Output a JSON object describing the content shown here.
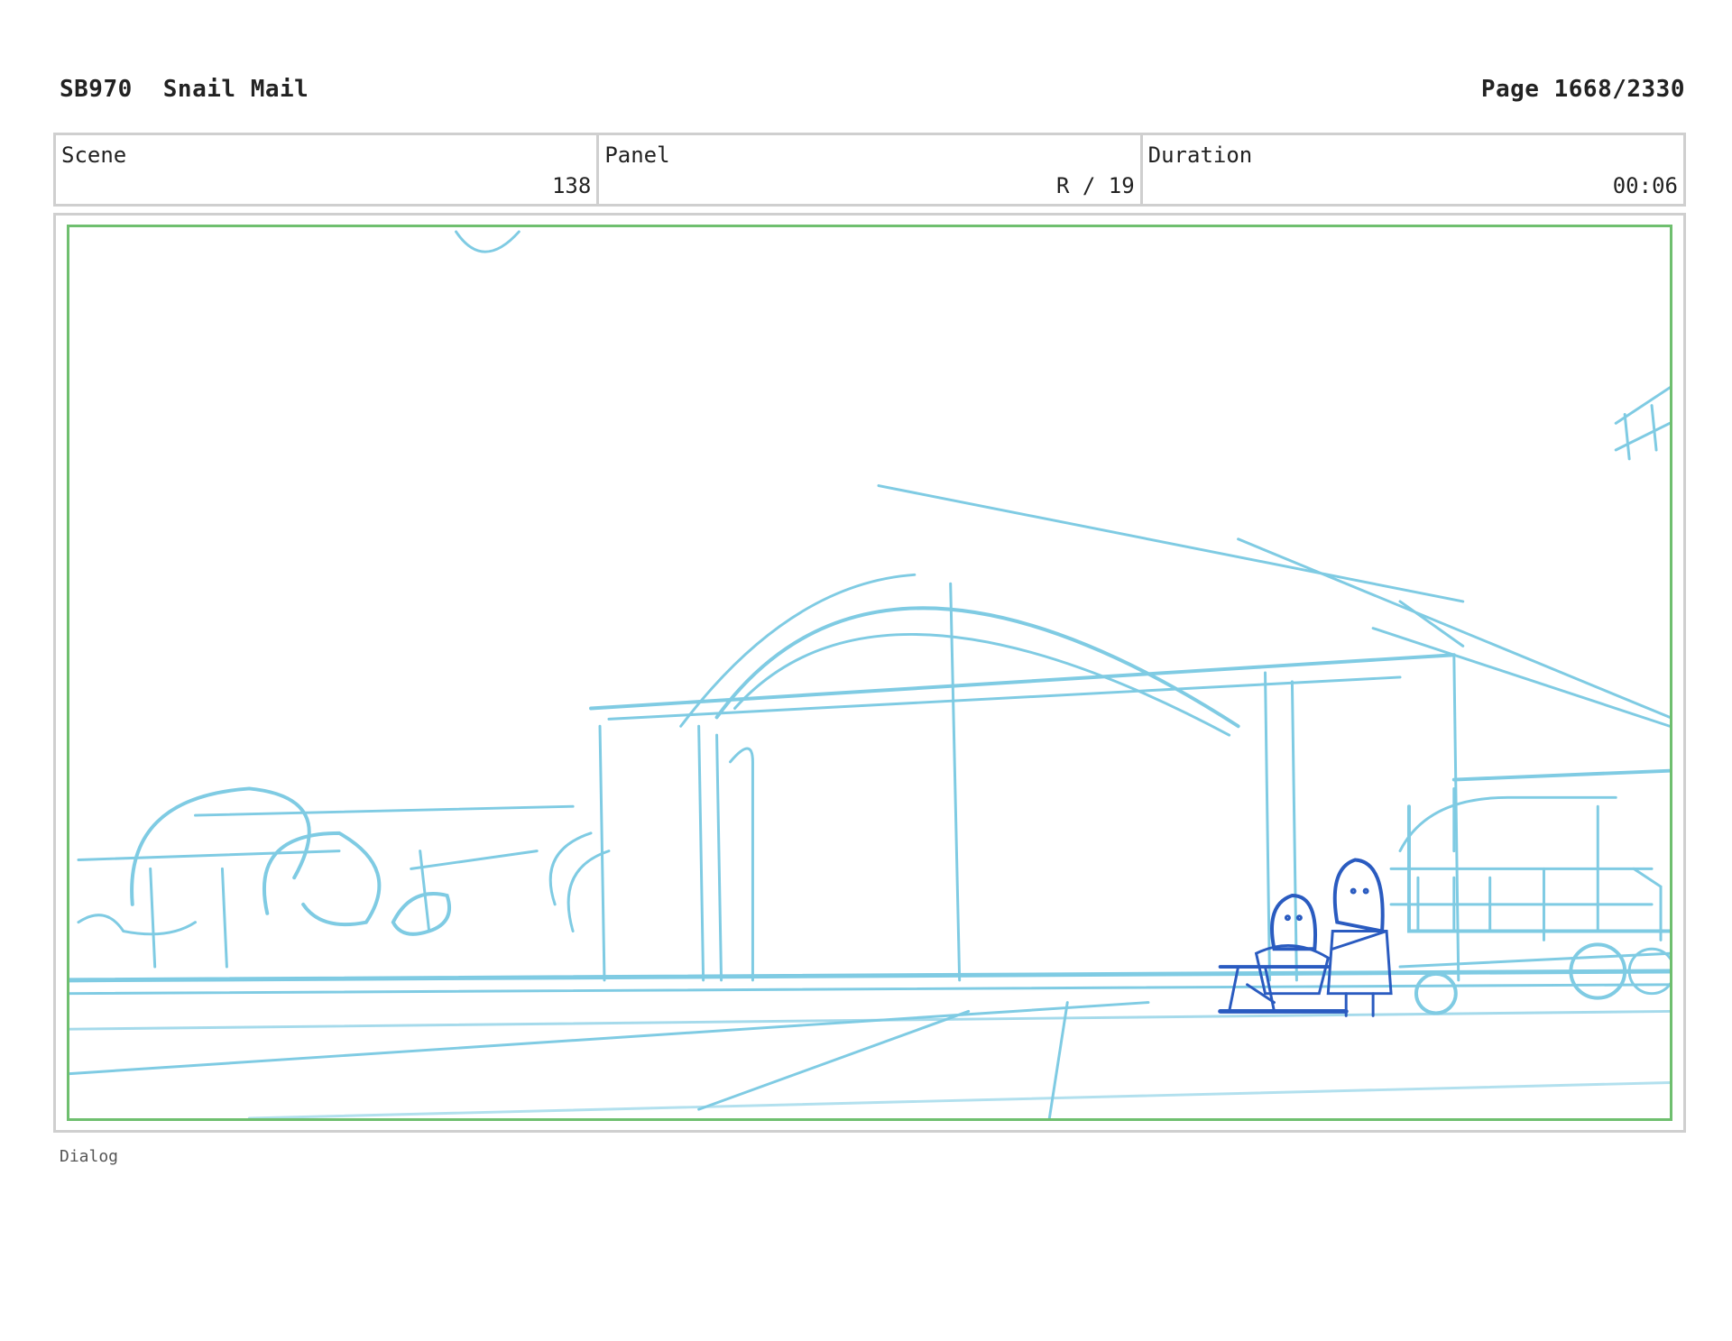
{
  "header": {
    "code": "SB970",
    "title": "Snail Mail",
    "page": "Page 1668/2330"
  },
  "info": {
    "scene_label": "Scene",
    "scene_value": "138",
    "panel_label": "Panel",
    "panel_value": "R / 19",
    "duration_label": "Duration",
    "duration_value": "00:06"
  },
  "panel": {
    "sketch_color": "#7fcbe3",
    "character_color": "#2a5bc0",
    "frame_color": "#6fbf6f"
  },
  "dialog": {
    "label": "Dialog"
  }
}
